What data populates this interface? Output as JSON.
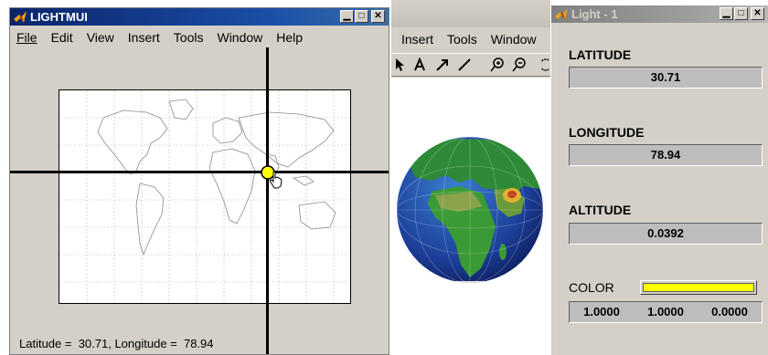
{
  "main_window": {
    "title": "LIGHTMUI",
    "menu": [
      "File",
      "Edit",
      "View",
      "Insert",
      "Tools",
      "Window",
      "Help"
    ],
    "status": "Latitude =  30.71, Longitude =  78.94"
  },
  "middle_window": {
    "menu": [
      "Insert",
      "Tools",
      "Window"
    ]
  },
  "light_window": {
    "title": "Light - 1",
    "latitude_label": "LATITUDE",
    "latitude_value": "30.71",
    "longitude_label": "LONGITUDE",
    "longitude_value": "78.94",
    "altitude_label": "ALTITUDE",
    "altitude_value": "0.0392",
    "color_label": "COLOR",
    "color_swatch": "#ffff00",
    "color_values": [
      "1.0000",
      "1.0000",
      "0.0000"
    ]
  },
  "colors": {
    "titlebar_active": "#0a246a",
    "titlebar_inactive": "#808080",
    "window_face": "#d4d0c8"
  },
  "icons": {
    "app": "matlab-logo-icon",
    "cursor": "hand-pointer-icon"
  }
}
